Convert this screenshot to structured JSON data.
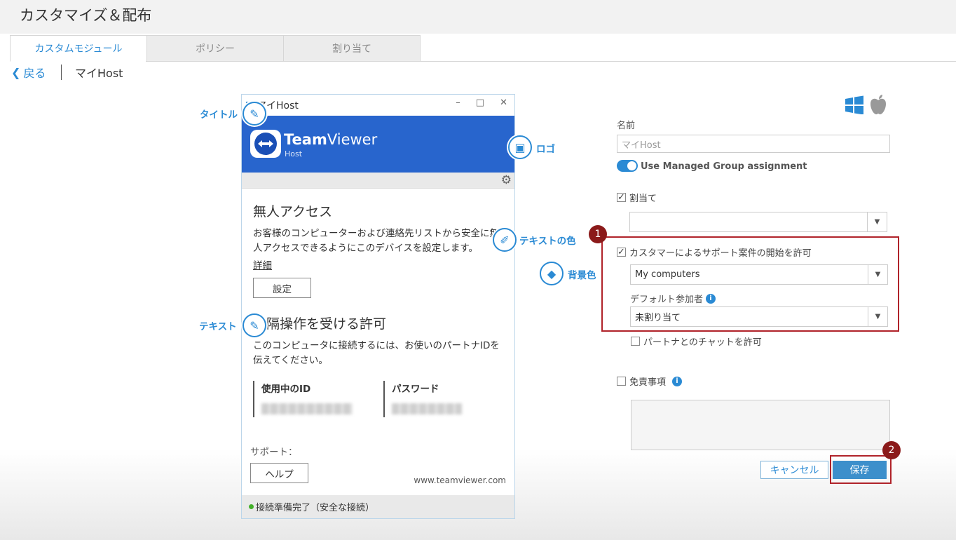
{
  "page": {
    "title": "カスタマイズ＆配布"
  },
  "tabs": [
    "カスタムモジュール",
    "ポリシー",
    "割り当て"
  ],
  "breadcrumb": {
    "back": "戻る",
    "current": "マイHost"
  },
  "preview": {
    "window_title": "マイHost",
    "brand_bold": "Team",
    "brand_light": "Viewer",
    "brand_sub": "Host",
    "unattended_title": "無人アクセス",
    "unattended_text_1": "お客様のコンピューターおよび連絡先リストから安全に無",
    "unattended_text_2": "人アクセスできるようにこのデバイスを設定します。",
    "details_link": "詳細",
    "setup_button": "設定",
    "remote_title": "遠隔操作を受ける許可",
    "remote_text_1": "このコンピュータに接続するには、お使いのパートナIDを",
    "remote_text_2": "伝えてください。",
    "id_label": "使用中のID",
    "password_label": "パスワード",
    "support_label": "サポート：",
    "help_button": "ヘルプ",
    "url": "www.teamviewer.com",
    "status": "接続準備完了（安全な接続）"
  },
  "callouts": {
    "title": "タイトル",
    "logo": "ロゴ",
    "text_color": "テキストの色",
    "background_color": "背景色",
    "text": "テキスト"
  },
  "form": {
    "name_label": "名前",
    "name_placeholder": "マイHost",
    "managed_group_label": "Use Managed Group assignment",
    "managed_group_on": true,
    "assign_label": "割当て",
    "assign_checked": true,
    "assign_value": "",
    "allow_support_label": "カスタマーによるサポート案件の開始を許可",
    "allow_support_checked": true,
    "group_value": "My computers",
    "default_participant_label": "デフォルト参加者",
    "default_participant_value": "未割り当て",
    "partner_chat_label": "パートナとのチャットを許可",
    "partner_chat_checked": false,
    "disclaimer_label": "免責事項",
    "disclaimer_checked": false,
    "cancel_button": "キャンセル",
    "save_button": "保存"
  },
  "badges": [
    "1",
    "2"
  ],
  "colors": {
    "accent": "#2a8ad4",
    "header_blue": "#2865cd",
    "highlight": "#b0232a",
    "badge": "#8b1a1a"
  }
}
